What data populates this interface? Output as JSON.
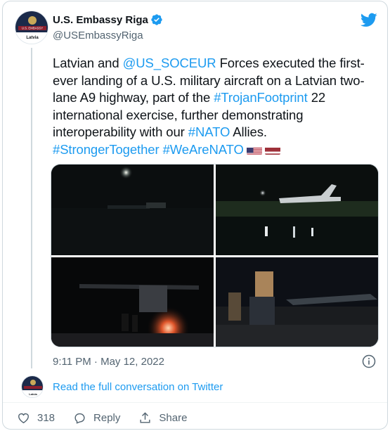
{
  "account": {
    "display_name": "U.S. Embassy Riga",
    "handle": "@USEmbassyRiga",
    "avatar_text_top": "U.S. EMBASSY",
    "avatar_text_bottom": "Latvia"
  },
  "tweet": {
    "text_1": "Latvian and ",
    "mention": "@US_SOCEUR",
    "text_2": " Forces executed the first-ever landing of a U.S. military aircraft on a Latvian two-lane A9 highway, part of the ",
    "hashtag_1": "#TrojanFootprint",
    "text_3": " 22 international exercise, further demonstrating interoperability with our ",
    "hashtag_2": "#NATO",
    "text_4": " Allies.",
    "hashtag_3": "#StrongerTogether",
    "hashtag_4": "#WeAreNATO",
    "flags": [
      "us-flag-icon",
      "latvia-flag-icon"
    ]
  },
  "media": {
    "photos": [
      "night-aircraft-landing-photo",
      "aircraft-reflection-photo",
      "aircraft-rear-lights-photo",
      "soldiers-watching-aircraft-photo"
    ]
  },
  "timestamp": "9:11 PM · May 12, 2022",
  "read_more": "Read the full conversation on Twitter",
  "actions": {
    "like_count": "318",
    "reply_label": "Reply",
    "share_label": "Share"
  },
  "colors": {
    "link": "#1d9bf0",
    "secondary_text": "#536471",
    "border": "#cfd9de",
    "like_red": "#f4212e",
    "embassy_navy": "#1b2a4a"
  }
}
